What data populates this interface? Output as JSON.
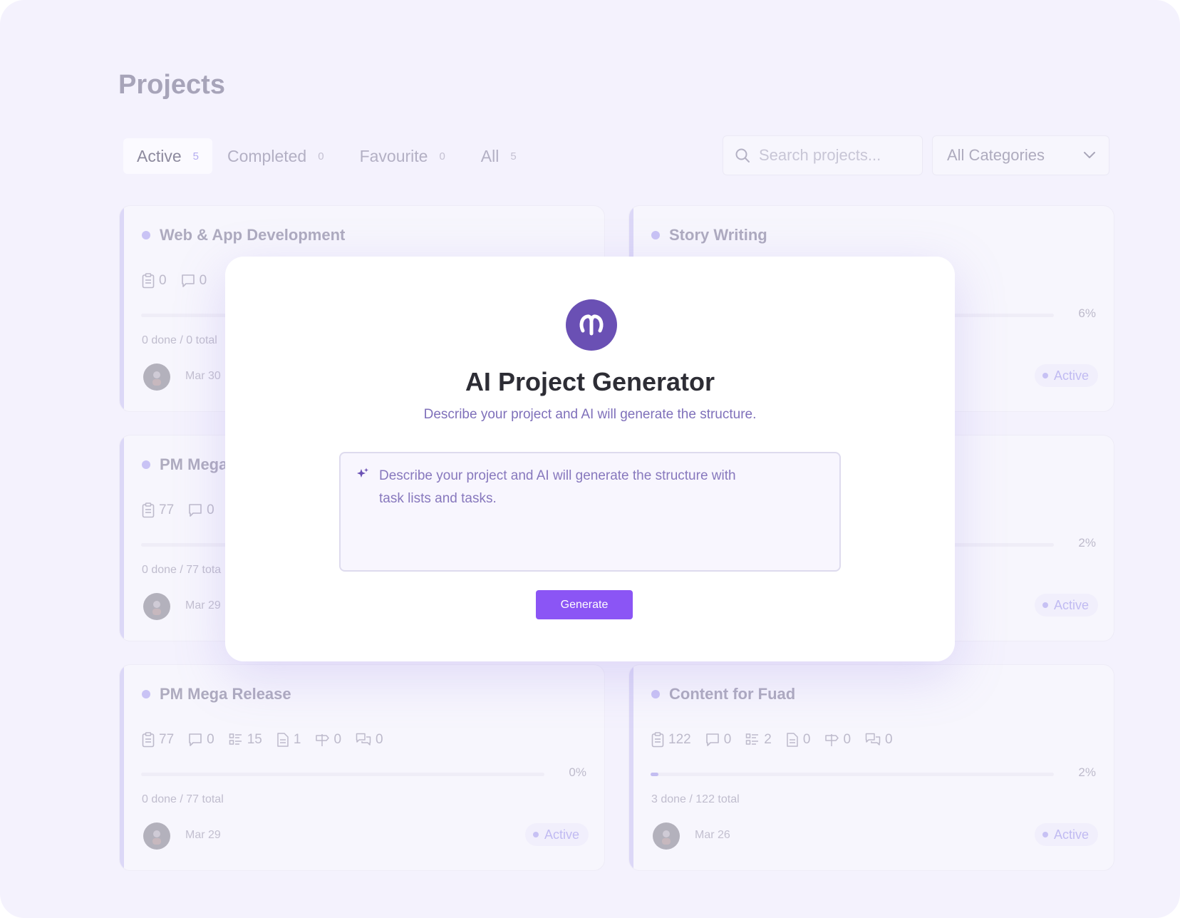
{
  "page": {
    "title": "Projects"
  },
  "tabs": [
    {
      "label": "Active",
      "count": "5"
    },
    {
      "label": "Completed",
      "count": "0"
    },
    {
      "label": "Favourite",
      "count": "0"
    },
    {
      "label": "All",
      "count": "5"
    }
  ],
  "search": {
    "placeholder": "Search projects...",
    "icon": "search-icon"
  },
  "category_filter": {
    "selected": "All Categories",
    "icon": "chevron-down-icon"
  },
  "cards": [
    {
      "title": "Web & App Development",
      "stats": [
        "0",
        "0"
      ],
      "progress": 0,
      "progress_label": "",
      "done_text": "0 done / 0 total",
      "date": "Mar 30",
      "status": ""
    },
    {
      "title": "Story Writing",
      "stats": [],
      "progress": 6,
      "progress_label": "6%",
      "done_text": "",
      "date": "",
      "status": "Active"
    },
    {
      "title": "PM Mega",
      "stats": [
        "77",
        "0"
      ],
      "progress": 0,
      "progress_label": "",
      "done_text": "0 done / 77 tota",
      "date": "Mar 29",
      "status": ""
    },
    {
      "title": "",
      "stats": [],
      "progress": 2,
      "progress_label": "2%",
      "done_text": "",
      "date": "",
      "status": "Active"
    },
    {
      "title": "PM Mega Release",
      "stats": [
        "77",
        "0",
        "15",
        "1",
        "0",
        "0"
      ],
      "progress": 0,
      "progress_label": "0%",
      "done_text": "0 done / 77 total",
      "date": "Mar 29",
      "status": "Active"
    },
    {
      "title": "Content for Fuad",
      "stats": [
        "122",
        "0",
        "2",
        "0",
        "0",
        "0"
      ],
      "progress": 2,
      "progress_label": "2%",
      "done_text": "3 done / 122 total",
      "date": "Mar 26",
      "status": "Active"
    }
  ],
  "modal": {
    "title": "AI Project Generator",
    "subtitle": "Describe your project and AI will generate the structure.",
    "prompt_text": "Describe your project and AI will generate the structure with task lists and tasks.",
    "button_label": "Generate",
    "logo": "brand-logo",
    "accent": "#8b55f5",
    "logo_color": "#6a50b4"
  }
}
